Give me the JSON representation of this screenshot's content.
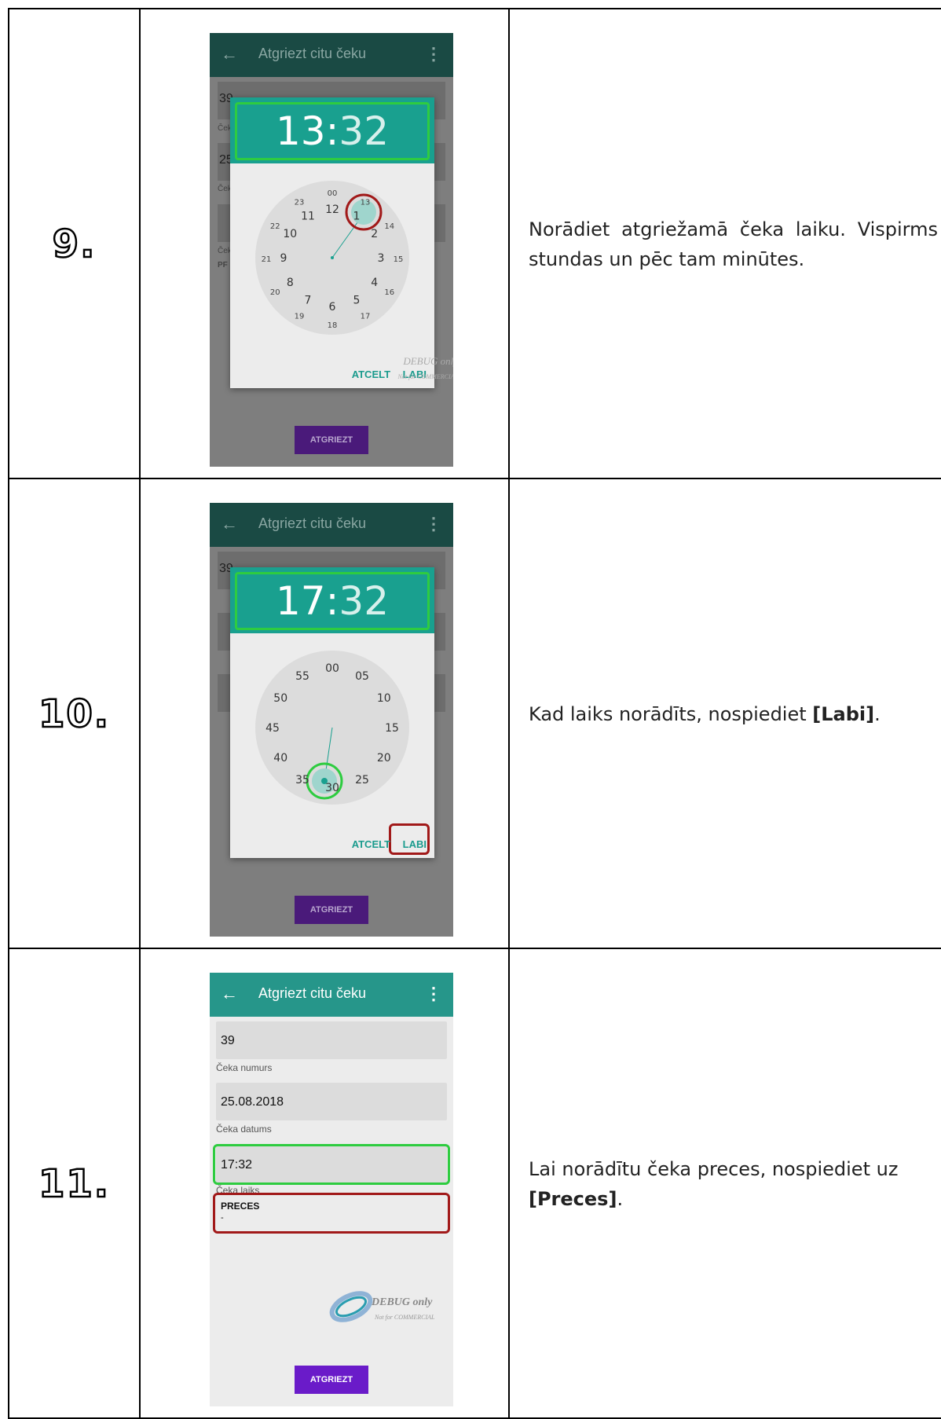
{
  "steps": [
    {
      "number": "9.",
      "description": "Norādiet atgriežamā čeka laiku. Vispirms stundas un pēc tam minūtes.",
      "screen": {
        "app_title": "Atgriezt citu čeku",
        "field_value": "39",
        "field2_value": "25",
        "label_short": "Ček",
        "preces_short": "PF",
        "time_hours": "13",
        "time_separator": ":",
        "time_minutes": "32",
        "clock_outer": [
          "00",
          "1",
          "2",
          "3",
          "4",
          "5",
          "6",
          "7",
          "8",
          "9",
          "10",
          "11",
          "12"
        ],
        "clock_inner": [
          "13",
          "14",
          "15",
          "16",
          "17",
          "18",
          "19",
          "20",
          "21",
          "22",
          "23"
        ],
        "cancel_label": "ATCELT",
        "ok_label": "LABI",
        "watermark_top": "DEBUG only",
        "watermark_bottom": "Not for COMMERCIAL",
        "submit_label": "ATGRIEZT"
      }
    },
    {
      "number": "10.",
      "description_prefix": "Kad laiks norādīts, nospiediet ",
      "description_bold": "[Labi]",
      "description_suffix": ".",
      "screen": {
        "app_title": "Atgriezt citu čeku",
        "field_value": "39",
        "time_hours": "17",
        "time_separator": ":",
        "time_minutes": "32",
        "minutes_labels": [
          "00",
          "05",
          "10",
          "15",
          "20",
          "25",
          "30",
          "35",
          "40",
          "45",
          "50",
          "55"
        ],
        "cancel_label": "ATCELT",
        "ok_label": "LABI",
        "submit_label": "ATGRIEZT"
      }
    },
    {
      "number": "11.",
      "description_prefix": "Lai norādītu čeka preces, nospiediet uz ",
      "description_bold": "[Preces]",
      "description_suffix": ".",
      "screen": {
        "app_title": "Atgriezt citu čeku",
        "receipt_number": "39",
        "receipt_number_label": "Čeka numurs",
        "receipt_date": "25.08.2018",
        "receipt_date_label": "Čeka datums",
        "receipt_time": "17:32",
        "receipt_time_label": "Čeka laiks",
        "goods_label": "PRECES",
        "goods_value": "-",
        "watermark_top": "DEBUG only",
        "watermark_bottom": "Not for COMMERCIAL",
        "submit_label": "ATGRIEZT"
      }
    }
  ]
}
